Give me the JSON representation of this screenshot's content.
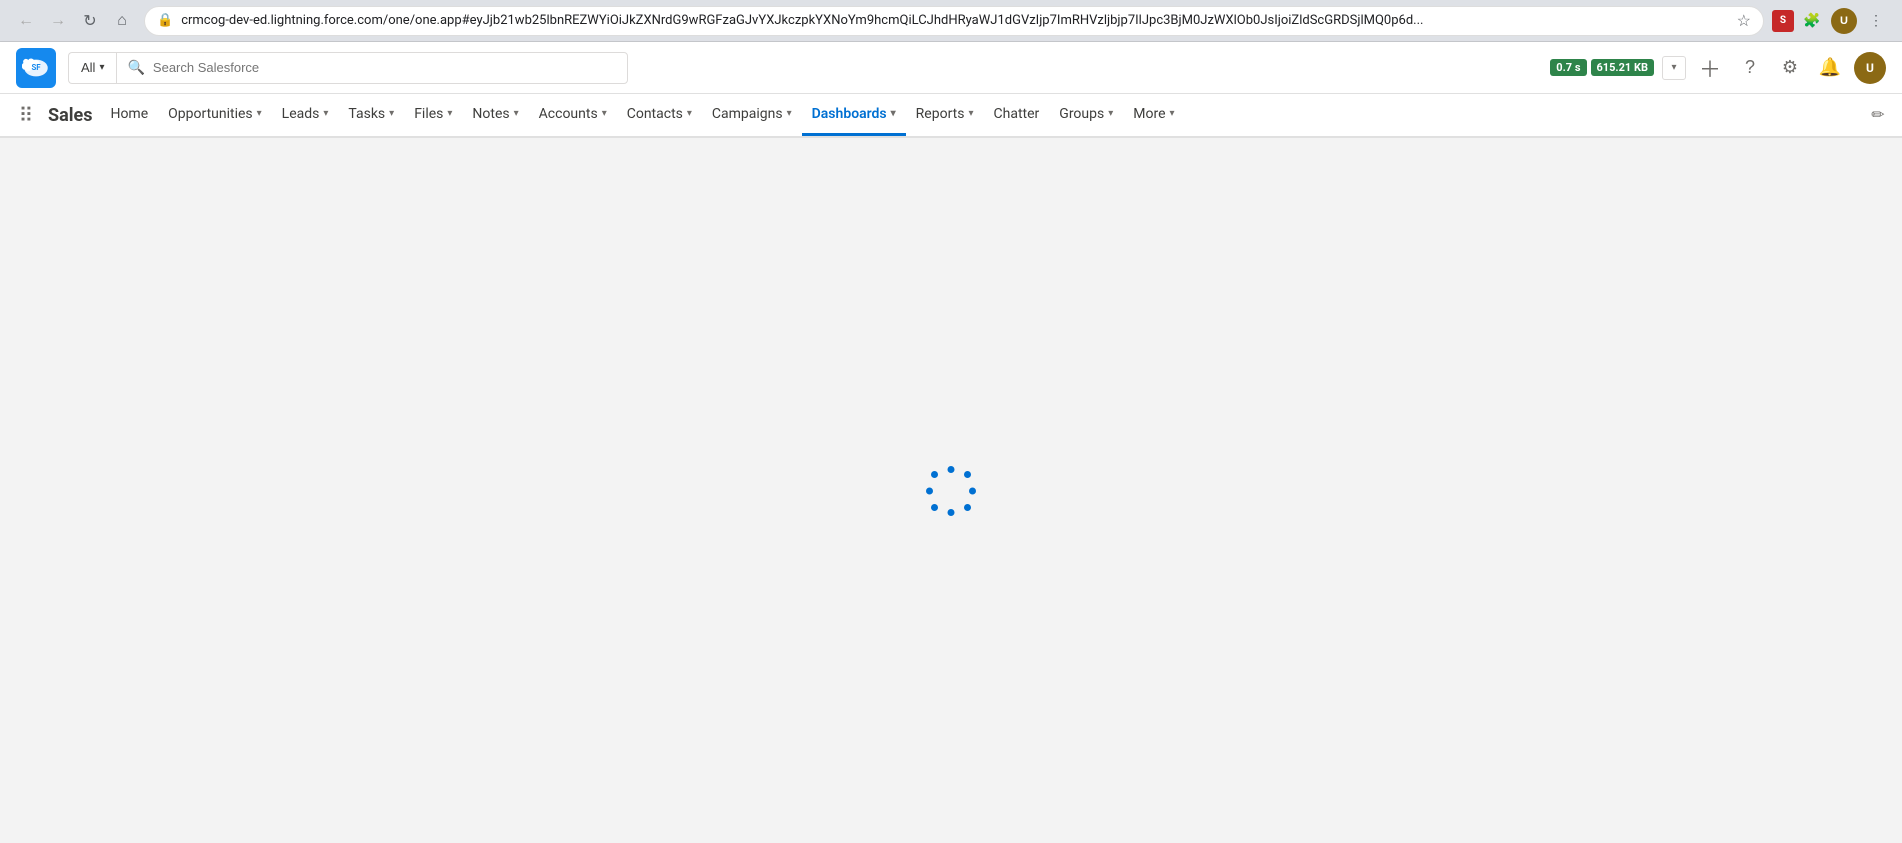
{
  "browser": {
    "url": "crmcog-dev-ed.lightning.force.com/one/one.app#eyJjb21wb25lbnREZWYiOiJkZXNrdG9wRGFzaGJvYXJkczpkYXNoYm9hcmQiLCJhdHRyaWJ1dGVzIjp7ImRHVzljbjp7IlJpc3BjM0JzWXlOb0JsIjoiZldScGRDSjlMQ0p6d...",
    "back_disabled": true,
    "forward_disabled": true
  },
  "header": {
    "search_placeholder": "Search Salesforce",
    "search_filter": "All",
    "perf_time": "0.7 s",
    "perf_size": "615.21 KB"
  },
  "nav": {
    "app_name": "Sales",
    "items": [
      {
        "label": "Home",
        "has_dropdown": false,
        "active": false
      },
      {
        "label": "Opportunities",
        "has_dropdown": true,
        "active": false
      },
      {
        "label": "Leads",
        "has_dropdown": true,
        "active": false
      },
      {
        "label": "Tasks",
        "has_dropdown": true,
        "active": false
      },
      {
        "label": "Files",
        "has_dropdown": true,
        "active": false
      },
      {
        "label": "Notes",
        "has_dropdown": true,
        "active": false
      },
      {
        "label": "Accounts",
        "has_dropdown": true,
        "active": false
      },
      {
        "label": "Contacts",
        "has_dropdown": true,
        "active": false
      },
      {
        "label": "Campaigns",
        "has_dropdown": true,
        "active": false
      },
      {
        "label": "Dashboards",
        "has_dropdown": true,
        "active": true
      },
      {
        "label": "Reports",
        "has_dropdown": true,
        "active": false
      },
      {
        "label": "Chatter",
        "has_dropdown": false,
        "active": false
      },
      {
        "label": "Groups",
        "has_dropdown": true,
        "active": false
      },
      {
        "label": "More",
        "has_dropdown": true,
        "active": false
      }
    ]
  },
  "content": {
    "loading": true
  }
}
